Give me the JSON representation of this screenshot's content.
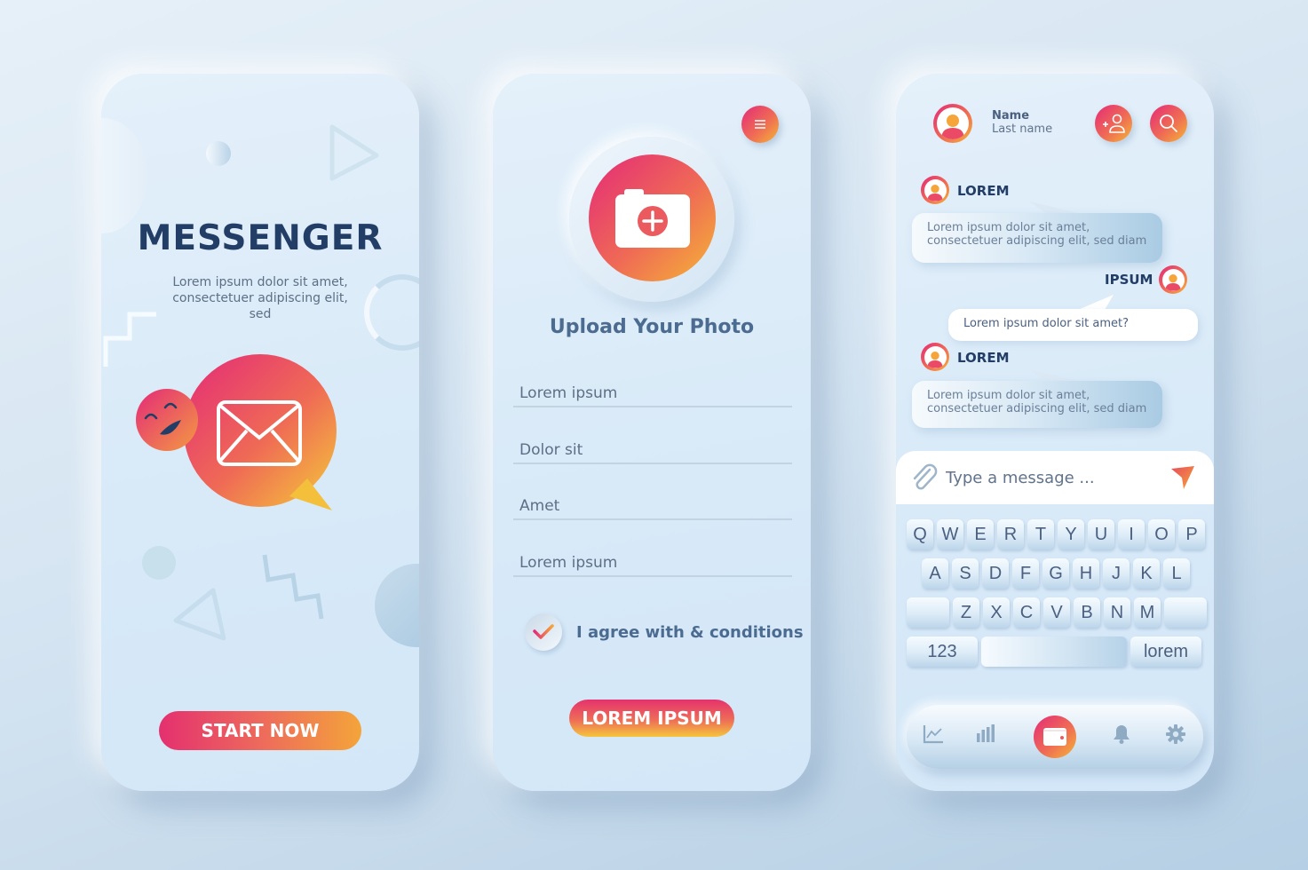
{
  "colors": {
    "accent_start": "#e42a78",
    "accent_mid": "#ef6b55",
    "accent_end": "#f5b536",
    "heading": "#223d66",
    "body_text": "#5d6f86",
    "field_line": "#c2d3e2"
  },
  "welcome_screen": {
    "title": "MESSENGER",
    "subtitle": "Lorem ipsum dolor sit amet, consectetuer adipiscing elit, sed",
    "hero_icons": [
      "envelope-icon",
      "laughing-emoji-icon"
    ],
    "cta_label": "START NOW"
  },
  "upload_screen": {
    "menu_icon": "hamburger-menu-icon",
    "upload_icon": "camera-plus-icon",
    "title": "Upload Your Photo",
    "fields": [
      {
        "placeholder": "Lorem ipsum",
        "value": ""
      },
      {
        "placeholder": "Dolor sit",
        "value": ""
      },
      {
        "placeholder": "Amet",
        "value": ""
      },
      {
        "placeholder": "Lorem ipsum",
        "value": ""
      }
    ],
    "agree": {
      "label": "I agree with & conditions",
      "checked": true
    },
    "submit_label": "LOREM IPSUM"
  },
  "chat_screen": {
    "header": {
      "name": "Name",
      "last_name": "Last name",
      "add_user_icon": "add-user-icon",
      "search_icon": "search-icon"
    },
    "messages": [
      {
        "sender": "LOREM",
        "direction": "incoming",
        "text": "Lorem ipsum dolor sit amet, consectetuer adipiscing elit, sed diam"
      },
      {
        "sender": "IPSUM",
        "direction": "outgoing",
        "text": "Lorem ipsum dolor sit amet?"
      },
      {
        "sender": "LOREM",
        "direction": "incoming",
        "text": "Lorem ipsum dolor sit amet, consectetuer adipiscing elit, sed diam"
      }
    ],
    "composer": {
      "placeholder": "Type a message ...",
      "value": "",
      "attach_icon": "paperclip-icon",
      "send_icon": "send-icon"
    },
    "keyboard": {
      "row1": [
        "Q",
        "W",
        "E",
        "R",
        "T",
        "Y",
        "U",
        "I",
        "O",
        "P"
      ],
      "row2": [
        "A",
        "S",
        "D",
        "F",
        "G",
        "H",
        "J",
        "K",
        "L"
      ],
      "row3": [
        "Z",
        "X",
        "C",
        "V",
        "B",
        "N",
        "M"
      ],
      "numbers_label": "123",
      "return_label": "lorem"
    },
    "nav": [
      {
        "icon": "line-chart-icon",
        "active": false
      },
      {
        "icon": "bar-chart-icon",
        "active": false
      },
      {
        "icon": "wallet-icon",
        "active": true
      },
      {
        "icon": "bell-icon",
        "active": false
      },
      {
        "icon": "gear-icon",
        "active": false
      }
    ]
  }
}
